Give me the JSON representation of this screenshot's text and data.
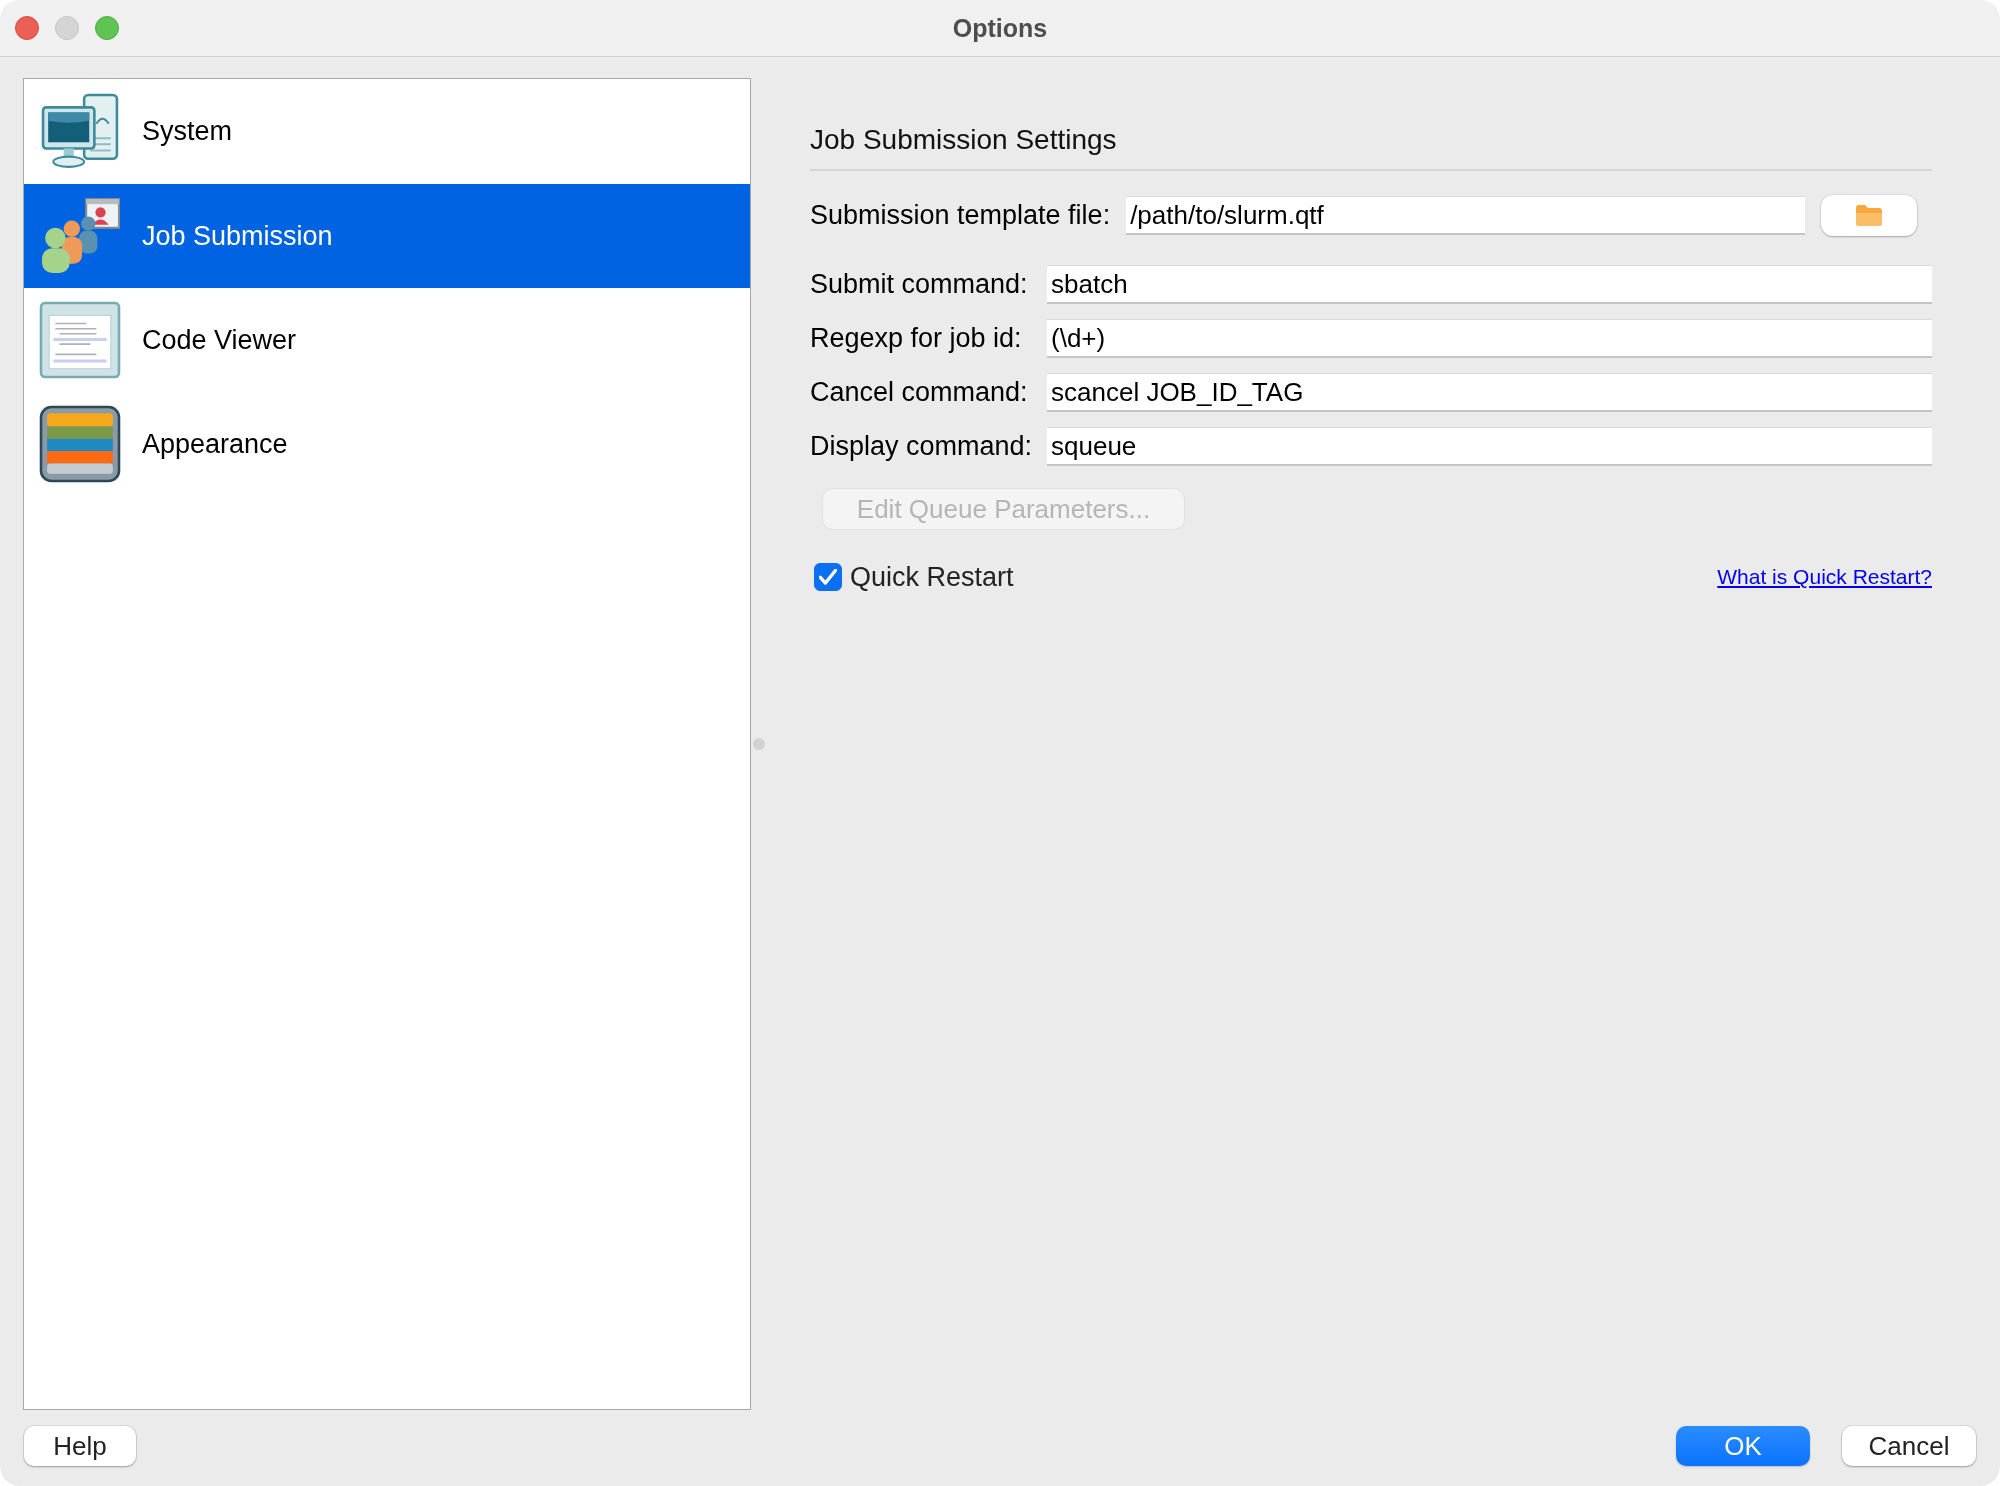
{
  "window": {
    "title": "Options"
  },
  "sidebar": {
    "items": [
      {
        "label": "System",
        "kind": "computer",
        "selected": false
      },
      {
        "label": "Job Submission",
        "kind": "people",
        "selected": true
      },
      {
        "label": "Code Viewer",
        "kind": "document",
        "selected": false
      },
      {
        "label": "Appearance",
        "kind": "stripes",
        "selected": false
      }
    ]
  },
  "settings": {
    "title": "Job Submission Settings",
    "template_file": {
      "label": "Submission template file:",
      "value": "/path/to/slurm.qtf"
    },
    "fields": [
      {
        "label": "Submit command:",
        "value": "sbatch"
      },
      {
        "label": "Regexp for job id:",
        "value": "(\\d+)"
      },
      {
        "label": "Cancel command:",
        "value": "scancel JOB_ID_TAG"
      },
      {
        "label": "Display command:",
        "value": "squeue"
      }
    ],
    "edit_queue_button": {
      "label": "Edit Queue Parameters...",
      "disabled": true
    },
    "quick_restart": {
      "label": "Quick Restart",
      "checked": true
    },
    "help_link": "What is Quick Restart?"
  },
  "footer": {
    "help_button": "Help",
    "ok_button": "OK",
    "cancel_button": "Cancel"
  }
}
